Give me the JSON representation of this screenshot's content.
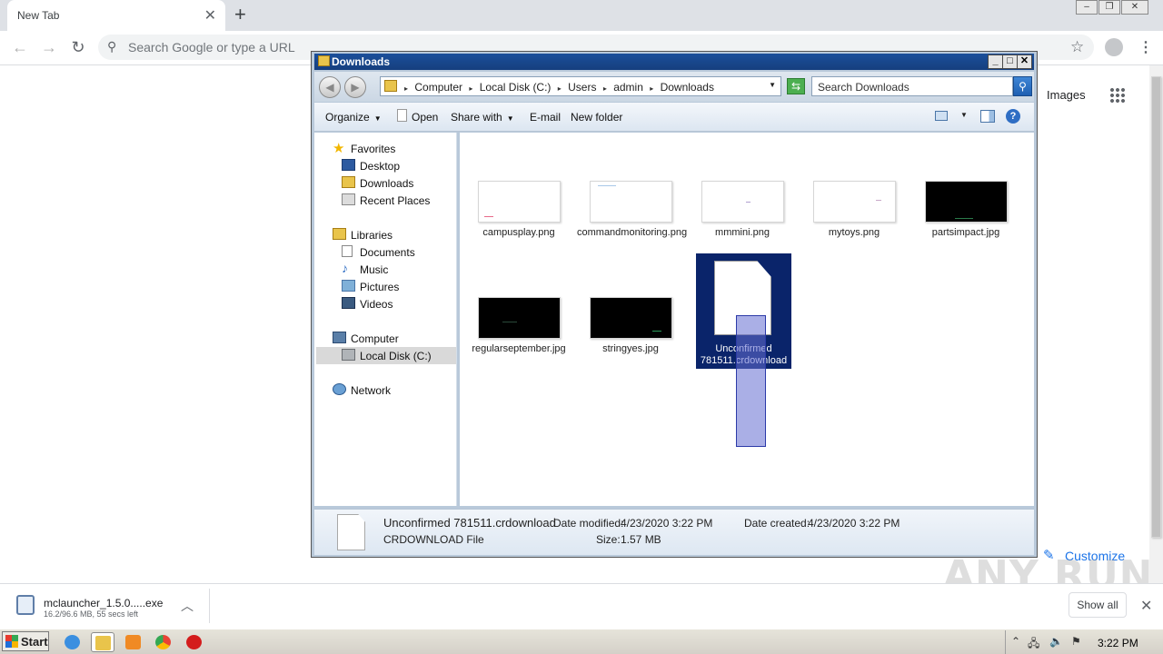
{
  "browser": {
    "tab_title": "New Tab",
    "tab_close": "✕",
    "new_tab": "+",
    "omnibox_placeholder": "Search Google or type a URL",
    "ntp_images": "Images",
    "customize": "Customize",
    "win_controls": [
      "–",
      "❐",
      "✕"
    ]
  },
  "explorer": {
    "title": "Downloads",
    "caption_buttons": [
      "_",
      "□",
      "✕"
    ],
    "breadcrumbs": [
      "Computer",
      "Local Disk (C:)",
      "Users",
      "admin",
      "Downloads"
    ],
    "search_placeholder": "Search Downloads",
    "commands": {
      "organize": "Organize",
      "open": "Open",
      "share_with": "Share with",
      "email": "E-mail",
      "new_folder": "New folder"
    },
    "nav": {
      "favorites": "Favorites",
      "desktop": "Desktop",
      "downloads": "Downloads",
      "recent_places": "Recent Places",
      "libraries": "Libraries",
      "documents": "Documents",
      "music": "Music",
      "pictures": "Pictures",
      "videos": "Videos",
      "computer": "Computer",
      "local_disk": "Local Disk (C:)",
      "network": "Network"
    },
    "files": {
      "f1": "campusplay.png",
      "f2": "commandmonitoring.png",
      "f3": "mmmini.png",
      "f4": "mytoys.png",
      "f5": "partsimpact.jpg",
      "f6": "regularseptember.jpg",
      "f7": "stringyes.jpg",
      "f8": "Unconfirmed 781511.crdownload"
    },
    "details": {
      "name": "Unconfirmed 781511.crdownload",
      "type": "CRDOWNLOAD File",
      "date_modified_label": "Date modified:",
      "date_modified": "4/23/2020 3:22 PM",
      "date_created_label": "Date created:",
      "date_created": "4/23/2020 3:22 PM",
      "size_label": "Size:",
      "size": "1.57 MB"
    }
  },
  "download_shelf": {
    "file_name": "mclauncher_1.5.0.....exe",
    "status": "16.2/96.6 MB, 55 secs left",
    "show_all": "Show all"
  },
  "taskbar": {
    "start": "Start",
    "clock": "3:22 PM"
  },
  "watermark": "ANY RUN"
}
